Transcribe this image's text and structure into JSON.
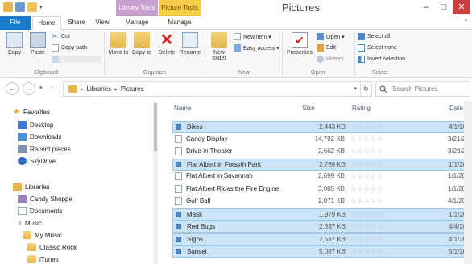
{
  "window": {
    "title": "Pictures",
    "contextual_tabs": [
      "Library Tools",
      "Picture Tools"
    ],
    "controls": [
      "–",
      "□",
      "✕"
    ]
  },
  "ribbon_tabs": [
    "File",
    "Home",
    "Share",
    "View",
    "Manage",
    "Manage"
  ],
  "ribbon": {
    "clipboard": {
      "group": "Clipboard",
      "copy": "Copy",
      "paste": "Paste",
      "cut": "Cut",
      "copy_path": "Copy path"
    },
    "organize": {
      "group": "Organize",
      "move_to": "Move to",
      "copy_to": "Copy to",
      "delete": "Delete",
      "rename": "Rename"
    },
    "new": {
      "group": "New",
      "new_folder": "New folder",
      "new_item": "New item ▾",
      "easy_access": "Easy access ▾"
    },
    "open": {
      "group": "Open",
      "properties": "Properties",
      "open": "Open ▾",
      "edit": "Edit",
      "history": "History"
    },
    "select": {
      "group": "Select",
      "select_all": "Select all",
      "select_none": "Select none",
      "invert": "Invert selection"
    }
  },
  "address": {
    "crumbs": [
      "Libraries",
      "Pictures"
    ],
    "separator": "▸",
    "search_placeholder": "Search Pictures"
  },
  "nav": {
    "favorites": "Favorites",
    "desktop": "Desktop",
    "downloads": "Downloads",
    "recent": "Recent places",
    "skydrive": "SkyDrive",
    "libraries": "Libraries",
    "candy": "Candy Shoppe",
    "documents": "Documents",
    "music": "Music",
    "mymusic": "My Music",
    "classic": "Classic Rock",
    "itunes": "iTunes"
  },
  "columns": {
    "name": "Name",
    "size": "Size",
    "rating": "Rating",
    "date": "Date"
  },
  "files": [
    {
      "name": "Bikes",
      "size": "2,443 KB",
      "date": "4/1/20",
      "selected": true
    },
    {
      "name": "Candy Display",
      "size": "14,702 KB",
      "date": "3/21/2",
      "selected": false
    },
    {
      "name": "Drive-in Theater",
      "size": "2,662 KB",
      "date": "3/28/2",
      "selected": false
    },
    {
      "name": "Flat Albert in Forsyth Park",
      "size": "2,769 KB",
      "date": "1/1/20",
      "selected": true
    },
    {
      "name": "Flat Albert in Savannah",
      "size": "2,699 KB",
      "date": "1/1/20",
      "selected": false
    },
    {
      "name": "Flat Albert Rides the Fire Engine",
      "size": "3,005 KB",
      "date": "1/1/20",
      "selected": false
    },
    {
      "name": "Golf Ball",
      "size": "2,871 KB",
      "date": "4/1/20",
      "selected": false
    },
    {
      "name": "Mask",
      "size": "1,979 KB",
      "date": "1/1/20",
      "selected": true
    },
    {
      "name": "Red Bugs",
      "size": "2,637 KB",
      "date": "4/4/20",
      "selected": true
    },
    {
      "name": "Signs",
      "size": "2,537 KB",
      "date": "4/1/20",
      "selected": true
    },
    {
      "name": "Sunset",
      "size": "5,087 KB",
      "date": "5/1/20",
      "selected": true
    }
  ],
  "rating_stars": "☆☆☆☆☆"
}
